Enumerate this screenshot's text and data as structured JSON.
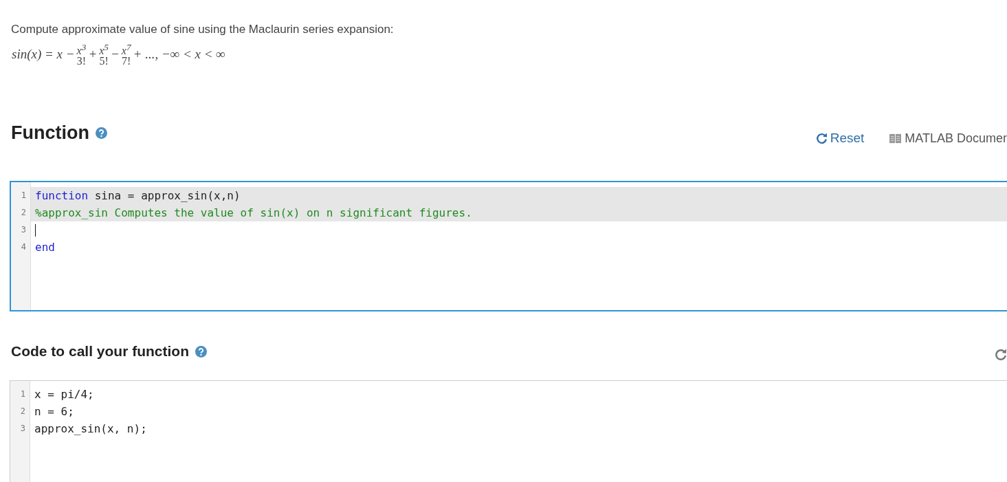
{
  "description": "Compute approximate value of sine using the Maclaurin series expansion:",
  "formula": [
    {
      "kind": "text",
      "text": "sin(x) = x −"
    },
    {
      "kind": "frac",
      "num": "x$^{3}$",
      "den": "3!"
    },
    {
      "kind": "text",
      "text": "+"
    },
    {
      "kind": "frac",
      "num": "x$^{5}$",
      "den": "5!"
    },
    {
      "kind": "text",
      "text": "−"
    },
    {
      "kind": "frac",
      "num": "x$^{7}$",
      "den": "7!"
    },
    {
      "kind": "text",
      "text": "+ ..., −∞ < x < ∞"
    }
  ],
  "function_section": {
    "title": "Function",
    "reset": "Reset",
    "docs": "MATLAB Documer",
    "editor": {
      "focused": true,
      "lines": [
        {
          "number": "1",
          "readonly": true,
          "cursor": false,
          "tokens": [
            {
              "kind": "keyword",
              "text": "function"
            },
            {
              "kind": "plain",
              "text": " sina = approx_sin(x,n)"
            }
          ]
        },
        {
          "number": "2",
          "readonly": true,
          "cursor": false,
          "tokens": [
            {
              "kind": "comment",
              "text": "%approx_sin Computes the value of sin(x) on n significant figures."
            }
          ]
        },
        {
          "number": "3",
          "readonly": false,
          "cursor": true
        },
        {
          "number": "4",
          "readonly": false,
          "cursor": false,
          "tokens": [
            {
              "kind": "keyword",
              "text": "end"
            }
          ]
        }
      ]
    }
  },
  "call_section": {
    "title": "Code to call your function",
    "editor": {
      "focused": false,
      "lines": [
        {
          "number": "1",
          "tokens": [
            {
              "kind": "plain",
              "text": "x = pi/4;"
            }
          ]
        },
        {
          "number": "2",
          "tokens": [
            {
              "kind": "plain",
              "text": "n = 6;"
            }
          ]
        },
        {
          "number": "3",
          "tokens": [
            {
              "kind": "plain",
              "text": "approx_sin(x, n);"
            }
          ]
        }
      ]
    }
  }
}
